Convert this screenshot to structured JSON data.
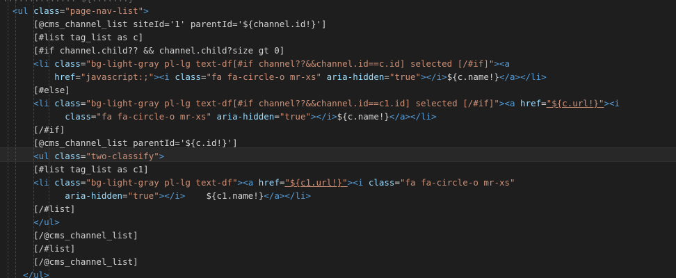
{
  "editor": {
    "top_fragment": ".............. ${.......}",
    "lines": [
      [
        [
          "tag",
          "<ul "
        ],
        [
          "attr",
          "class"
        ],
        [
          "txt",
          "="
        ],
        [
          "str",
          "\"page-nav-list\""
        ],
        [
          "tag",
          ">"
        ]
      ],
      [
        [
          "txt",
          "    [@cms_channel_list siteId='1' parentId='${channel.id!}']"
        ]
      ],
      [
        [
          "txt",
          "    [#list tag_list as c]"
        ]
      ],
      [
        [
          "txt",
          "    [#if channel.child?? && channel.child?size gt 0]"
        ]
      ],
      [
        [
          "tag",
          "    <li "
        ],
        [
          "attr",
          "class"
        ],
        [
          "txt",
          "="
        ],
        [
          "str",
          "\"bg-light-gray pl-lg text-df[#if channel??&&channel.id==c.id] selected [/#if]\""
        ],
        [
          "tag",
          "><a"
        ]
      ],
      [
        [
          "attr",
          "        href"
        ],
        [
          "txt",
          "="
        ],
        [
          "str",
          "\"javascript:;\""
        ],
        [
          "tag",
          "><i "
        ],
        [
          "attr",
          "class"
        ],
        [
          "txt",
          "="
        ],
        [
          "str",
          "\"fa fa-circle-o mr-xs\""
        ],
        [
          "txt",
          " "
        ],
        [
          "attr",
          "aria-hidden"
        ],
        [
          "txt",
          "="
        ],
        [
          "str",
          "\"true\""
        ],
        [
          "tag",
          "></i>"
        ],
        [
          "txt",
          "${c.name!}"
        ],
        [
          "tag",
          "</a></li>"
        ]
      ],
      [
        [
          "txt",
          "    [#else]"
        ]
      ],
      [
        [
          "tag",
          "    <li "
        ],
        [
          "attr",
          "class"
        ],
        [
          "txt",
          "="
        ],
        [
          "str",
          "\"bg-light-gray pl-lg text-df[#if channel??&&channel.id==c1.id] selected [/#if]\""
        ],
        [
          "tag",
          "><a "
        ],
        [
          "attr",
          "href"
        ],
        [
          "txt",
          "="
        ],
        [
          "str",
          "\"${c.url!}\""
        ],
        [
          "tag",
          "><i"
        ]
      ],
      [
        [
          "attr",
          "          class"
        ],
        [
          "txt",
          "="
        ],
        [
          "str",
          "\"fa fa-circle-o mr-xs\""
        ],
        [
          "txt",
          " "
        ],
        [
          "attr",
          "aria-hidden"
        ],
        [
          "txt",
          "="
        ],
        [
          "str",
          "\"true\""
        ],
        [
          "tag",
          "></i>"
        ],
        [
          "txt",
          "${c.name!}"
        ],
        [
          "tag",
          "</a></li>"
        ]
      ],
      [
        [
          "txt",
          "    [/#if]"
        ]
      ],
      [
        [
          "txt",
          "    [@cms_channel_list parentId='${c.id!}']"
        ]
      ],
      [
        [
          "tag",
          "    <ul "
        ],
        [
          "attr",
          "class"
        ],
        [
          "txt",
          "="
        ],
        [
          "str",
          "\"two-classify\""
        ],
        [
          "tag",
          ">"
        ]
      ],
      [
        [
          "txt",
          "    [#list tag_list as c1]"
        ]
      ],
      [
        [
          "tag",
          "    <li "
        ],
        [
          "attr",
          "class"
        ],
        [
          "txt",
          "="
        ],
        [
          "str",
          "\"bg-light-gray pl-lg text-df\""
        ],
        [
          "tag",
          "><a "
        ],
        [
          "attr",
          "href"
        ],
        [
          "txt",
          "="
        ],
        [
          "str",
          "\"${c1.url!}\""
        ],
        [
          "tag",
          "><i "
        ],
        [
          "attr",
          "class"
        ],
        [
          "txt",
          "="
        ],
        [
          "str",
          "\"fa fa-circle-o mr-xs\""
        ]
      ],
      [
        [
          "attr",
          "          aria-hidden"
        ],
        [
          "txt",
          "="
        ],
        [
          "str",
          "\"true\""
        ],
        [
          "tag",
          "></i>"
        ],
        [
          "txt",
          "    ${c1.name!}"
        ],
        [
          "tag",
          "</a></li>"
        ]
      ],
      [
        [
          "txt",
          "    [/#list]"
        ]
      ],
      [
        [
          "tag",
          "    </ul>"
        ]
      ],
      [
        [
          "txt",
          "    [/@cms_channel_list]"
        ]
      ],
      [
        [
          "txt",
          "    [/#list]"
        ]
      ],
      [
        [
          "txt",
          "    [/@cms_channel_list]"
        ]
      ],
      [
        [
          "tag",
          "  </ul>"
        ]
      ]
    ]
  }
}
